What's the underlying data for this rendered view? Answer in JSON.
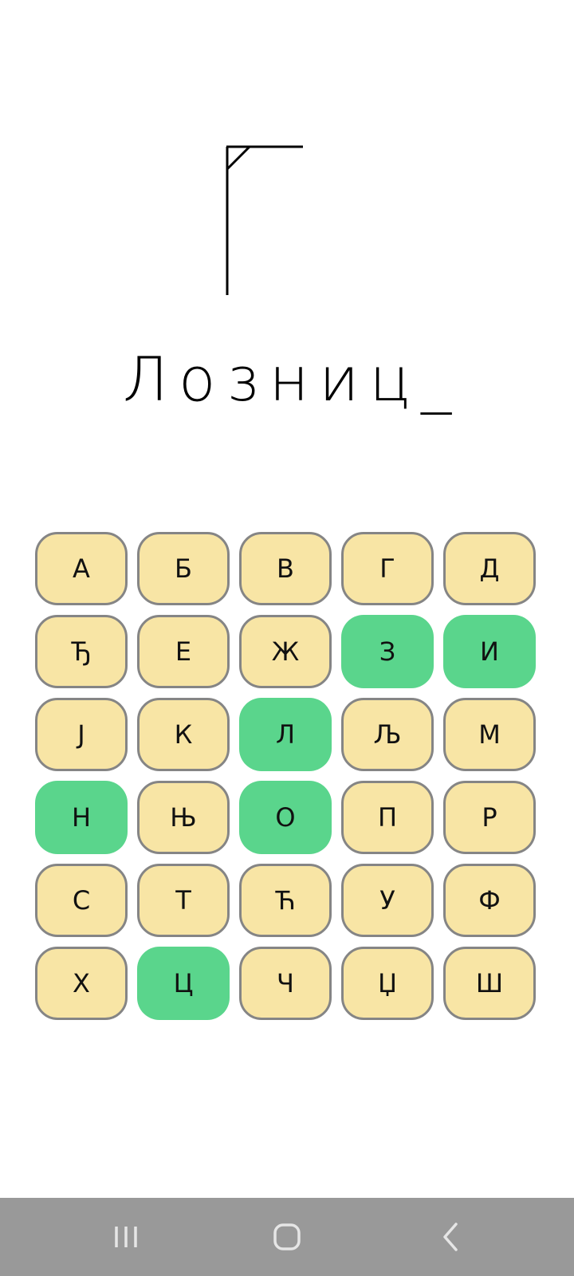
{
  "game": {
    "word": "Лозниц_",
    "letters": [
      {
        "char": "А",
        "used": false
      },
      {
        "char": "Б",
        "used": false
      },
      {
        "char": "В",
        "used": false
      },
      {
        "char": "Г",
        "used": false
      },
      {
        "char": "Д",
        "used": false
      },
      {
        "char": "Ђ",
        "used": false
      },
      {
        "char": "Е",
        "used": false
      },
      {
        "char": "Ж",
        "used": false
      },
      {
        "char": "З",
        "used": true
      },
      {
        "char": "И",
        "used": true
      },
      {
        "char": "Ј",
        "used": false
      },
      {
        "char": "К",
        "used": false
      },
      {
        "char": "Л",
        "used": true
      },
      {
        "char": "Љ",
        "used": false
      },
      {
        "char": "М",
        "used": false
      },
      {
        "char": "Н",
        "used": true
      },
      {
        "char": "Њ",
        "used": false
      },
      {
        "char": "О",
        "used": true
      },
      {
        "char": "П",
        "used": false
      },
      {
        "char": "Р",
        "used": false
      },
      {
        "char": "С",
        "used": false
      },
      {
        "char": "Т",
        "used": false
      },
      {
        "char": "Ћ",
        "used": false
      },
      {
        "char": "У",
        "used": false
      },
      {
        "char": "Ф",
        "used": false
      },
      {
        "char": "Х",
        "used": false
      },
      {
        "char": "Ц",
        "used": true
      },
      {
        "char": "Ч",
        "used": false
      },
      {
        "char": "Џ",
        "used": false
      },
      {
        "char": "Ш",
        "used": false
      }
    ]
  },
  "colors": {
    "key_unused": "#f8e5a5",
    "key_used": "#5ad58c",
    "key_border": "#858585",
    "navbar": "#999999"
  },
  "navbar": {
    "icons": [
      "recent-apps-icon",
      "home-icon",
      "back-icon"
    ]
  }
}
